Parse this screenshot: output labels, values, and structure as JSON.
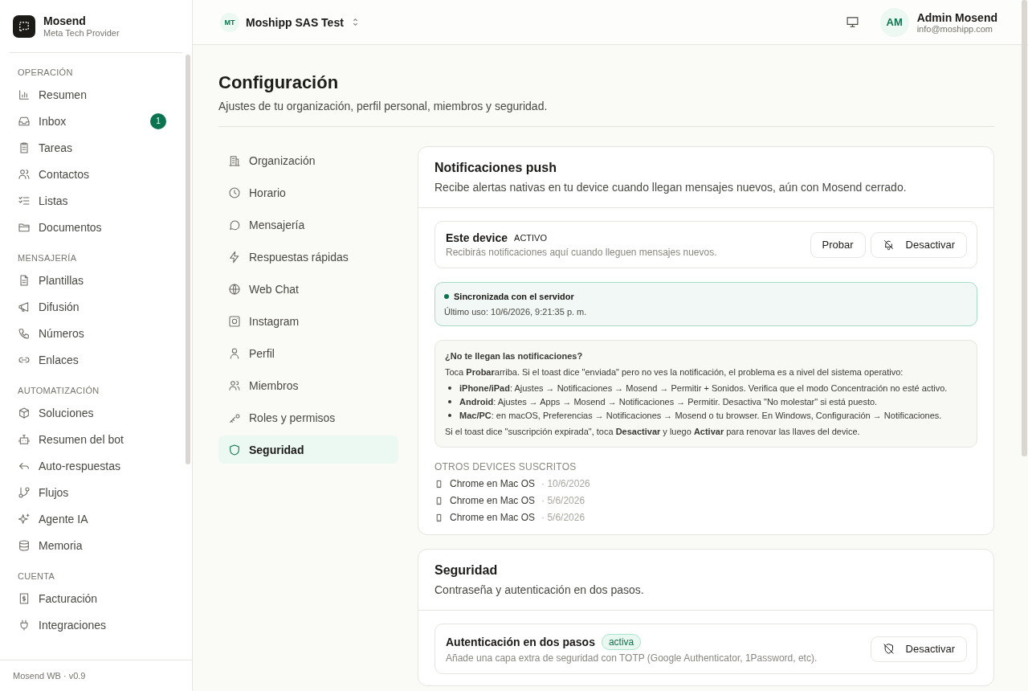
{
  "brand": {
    "name": "Mosend",
    "subtitle": "Meta Tech Provider"
  },
  "sidebar": {
    "sections": [
      {
        "title": "OPERACIÓN",
        "items": [
          {
            "label": "Resumen"
          },
          {
            "label": "Inbox",
            "badge": "1"
          },
          {
            "label": "Tareas"
          },
          {
            "label": "Contactos"
          },
          {
            "label": "Listas"
          },
          {
            "label": "Documentos"
          }
        ]
      },
      {
        "title": "MENSAJERÍA",
        "items": [
          {
            "label": "Plantillas"
          },
          {
            "label": "Difusión"
          },
          {
            "label": "Números"
          },
          {
            "label": "Enlaces"
          }
        ]
      },
      {
        "title": "AUTOMATIZACIÓN",
        "items": [
          {
            "label": "Soluciones"
          },
          {
            "label": "Resumen del bot"
          },
          {
            "label": "Auto-respuestas"
          },
          {
            "label": "Flujos"
          },
          {
            "label": "Agente IA"
          },
          {
            "label": "Memoria"
          }
        ]
      },
      {
        "title": "CUENTA",
        "items": [
          {
            "label": "Facturación"
          },
          {
            "label": "Integraciones"
          }
        ]
      }
    ],
    "footer": "Mosend WB · v0.9"
  },
  "topbar": {
    "org_initials": "MT",
    "org_name": "Moshipp SAS Test",
    "user_initials": "AM",
    "user_name": "Admin Mosend",
    "user_email": "info@moshipp.com"
  },
  "page": {
    "title": "Configuración",
    "subtitle": "Ajustes de tu organización, perfil personal, miembros y seguridad."
  },
  "settings_nav": [
    {
      "label": "Organización",
      "selected": false
    },
    {
      "label": "Horario",
      "selected": false
    },
    {
      "label": "Mensajería",
      "selected": false
    },
    {
      "label": "Respuestas rápidas",
      "selected": false
    },
    {
      "label": "Web Chat",
      "selected": false
    },
    {
      "label": "Instagram",
      "selected": false
    },
    {
      "label": "Perfil",
      "selected": false
    },
    {
      "label": "Miembros",
      "selected": false
    },
    {
      "label": "Roles y permisos",
      "selected": false
    },
    {
      "label": "Seguridad",
      "selected": true
    }
  ],
  "push_card": {
    "title": "Notificaciones push",
    "description": "Recibe alertas nativas en tu device cuando llegan mensajes nuevos, aún con Mosend cerrado.",
    "device": {
      "name": "Este device",
      "state": "ACTIVO",
      "description": "Recibirás notificaciones aquí cuando lleguen mensajes nuevos.",
      "buttons": [
        "Probar",
        "Desactivar"
      ]
    },
    "sync": {
      "synced": true,
      "title": "Sincronizada con el servidor",
      "last_use": "Último uso: 10/6/2026, 9:21:35 p. m."
    },
    "help": {
      "title": "¿No te llegan las notificaciones?",
      "intro": "Toca **Probar**arriba. Si el toast dice \"enviada\" pero no ves la notificación, el problema es a nivel del sistema operativo:",
      "bullets": [
        "**iPhone/iPad**: Ajustes → Notificaciones → Mosend → Permitir + Sonidos. Verifica que el modo Concentración no esté activo.",
        "**Android**: Ajustes → Apps → Mosend → Notificaciones → Permitir. Desactiva \"No molestar\" si está puesto.",
        "**Mac/PC**: en macOS, Preferencias → Notificaciones → Mosend o tu browser. En Windows, Configuración → Notificaciones."
      ],
      "outro": "Si el toast dice \"suscripción expirada\", toca **Desactivar** y luego **Activar** para renovar las llaves del device."
    },
    "others_title": "OTROS DEVICES SUSCRITOS",
    "others": [
      {
        "name": "Chrome en Mac OS",
        "date": "· 10/6/2026"
      },
      {
        "name": "Chrome en Mac OS",
        "date": "· 5/6/2026"
      },
      {
        "name": "Chrome en Mac OS",
        "date": "· 5/6/2026"
      }
    ]
  },
  "security_card": {
    "title": "Seguridad",
    "description": "Contraseña y autenticación en dos pasos.",
    "two_factor": {
      "name": "Autenticación en dos pasos",
      "badge": "activa",
      "active": true,
      "description": "Añade una capa extra de seguridad con TOTP (Google Authenticator, 1Password, etc).",
      "button": "Desactivar"
    }
  }
}
